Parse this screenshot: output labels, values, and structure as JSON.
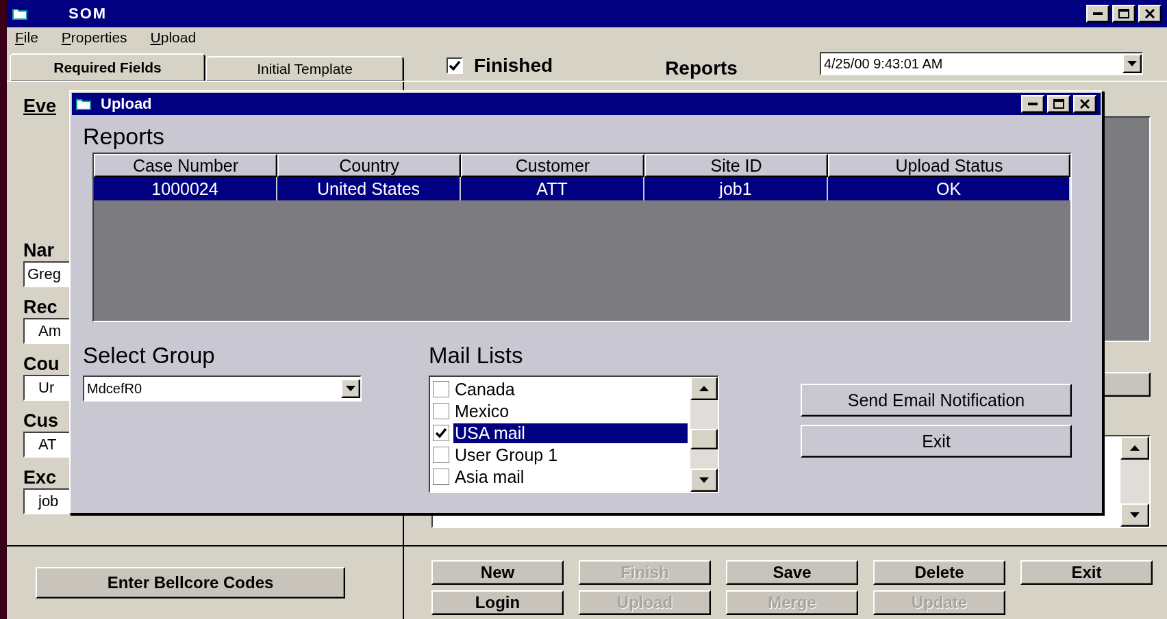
{
  "window": {
    "title": "SOM"
  },
  "menu": [
    "File",
    "Properties",
    "Upload"
  ],
  "tabs": [
    {
      "label": "Required Fields",
      "selected": true
    },
    {
      "label": "Initial Template",
      "selected": false
    }
  ],
  "finished": {
    "label": "Finished",
    "checked": true
  },
  "reports": {
    "label": "Reports",
    "value": "4/25/00 9:43:01 AM"
  },
  "left_fields": [
    {
      "label": "Eve"
    },
    {
      "label": "Nar",
      "value": "Greg"
    },
    {
      "label": "Rec",
      "value": "Am"
    },
    {
      "label": "Cou",
      "value": "Ur"
    },
    {
      "label": "Cus",
      "value": "AT"
    },
    {
      "label": "Exc",
      "value": "job"
    }
  ],
  "bellcore_button": "Enter Bellcore Codes",
  "actions": [
    [
      {
        "label": "New",
        "disabled": false
      },
      {
        "label": "Finish",
        "disabled": true
      },
      {
        "label": "Save",
        "disabled": false
      },
      {
        "label": "Delete",
        "disabled": false
      },
      {
        "label": "Exit",
        "disabled": false
      }
    ],
    [
      {
        "label": "Login",
        "disabled": false
      },
      {
        "label": "Upload",
        "disabled": true
      },
      {
        "label": "Merge",
        "disabled": true
      },
      {
        "label": "Update",
        "disabled": true
      }
    ]
  ],
  "dialog": {
    "title": "Upload",
    "heading": "Reports",
    "table": {
      "columns": [
        "Case Number",
        "Country",
        "Customer",
        "Site ID",
        "Upload Status"
      ],
      "rows": [
        {
          "cells": [
            "1000024",
            "United States",
            "ATT",
            "job1",
            "OK"
          ],
          "selected": true
        }
      ]
    },
    "group": {
      "label": "Select Group",
      "value": "MdcefR0"
    },
    "mail": {
      "label": "Mail Lists",
      "items": [
        {
          "label": "Canada",
          "checked": false,
          "selected": false
        },
        {
          "label": "Mexico",
          "checked": false,
          "selected": false
        },
        {
          "label": "USA mail",
          "checked": true,
          "selected": true
        },
        {
          "label": "User Group 1",
          "checked": false,
          "selected": false
        },
        {
          "label": "Asia mail",
          "checked": false,
          "selected": false
        }
      ]
    },
    "buttons": [
      "Send Email Notification",
      "Exit"
    ]
  }
}
